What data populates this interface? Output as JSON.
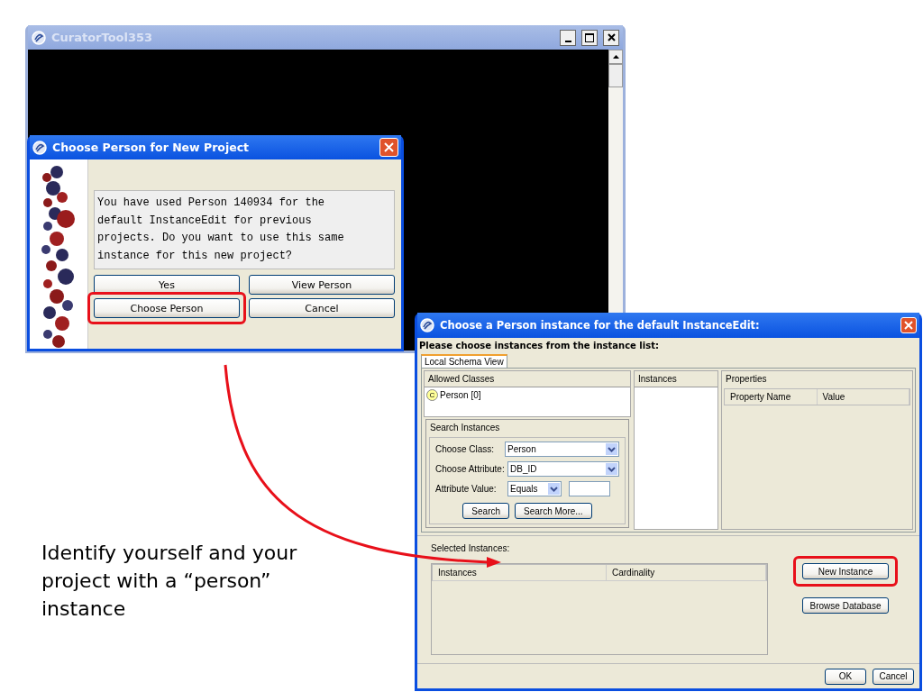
{
  "main_window": {
    "title": "CuratorTool353"
  },
  "person_dialog": {
    "title": "Choose Person for New Project",
    "message": "You have used Person 140934 for the default InstanceEdit for previous projects. Do you want to use this same instance for this new project?",
    "buttons": [
      {
        "label": "Yes",
        "highlighted": false
      },
      {
        "label": "View Person",
        "highlighted": false
      },
      {
        "label": "Choose Person",
        "highlighted": true
      },
      {
        "label": "Cancel",
        "highlighted": false
      }
    ]
  },
  "instance_dialog": {
    "title": "Choose a Person instance for the default InstanceEdit:",
    "prompt": "Please choose instances from the instance list:",
    "tabs": [
      {
        "label": "Local Schema View",
        "selected": true
      }
    ],
    "allowed_classes": {
      "title": "Allowed Classes",
      "items": [
        {
          "badge": "C",
          "label": "Person [0]"
        }
      ]
    },
    "search": {
      "title": "Search Instances",
      "fields": [
        {
          "kind": "dropdown",
          "label": "Choose Class:",
          "value": "Person"
        },
        {
          "kind": "dropdown",
          "label": "Choose Attribute:",
          "value": "DB_ID"
        },
        {
          "kind": "dropdown-with-text",
          "label": "Attribute Value:",
          "value": "Equals"
        }
      ],
      "buttons": [
        "Search",
        "Search More..."
      ]
    },
    "instances": {
      "title": "Instances"
    },
    "properties": {
      "title": "Properties",
      "columns": [
        "Property Name",
        "Value"
      ]
    },
    "selected_instances": {
      "label": "Selected Instances:",
      "columns": [
        "Instances",
        "Cardinality"
      ]
    },
    "side_buttons": [
      {
        "label": "New Instance",
        "highlighted": true
      },
      {
        "label": "Browse Database",
        "highlighted": false
      }
    ],
    "footer_buttons": [
      "OK",
      "Cancel"
    ]
  },
  "annotation": {
    "text": "Identify yourself and your\nproject with a “person”\ninstance"
  }
}
